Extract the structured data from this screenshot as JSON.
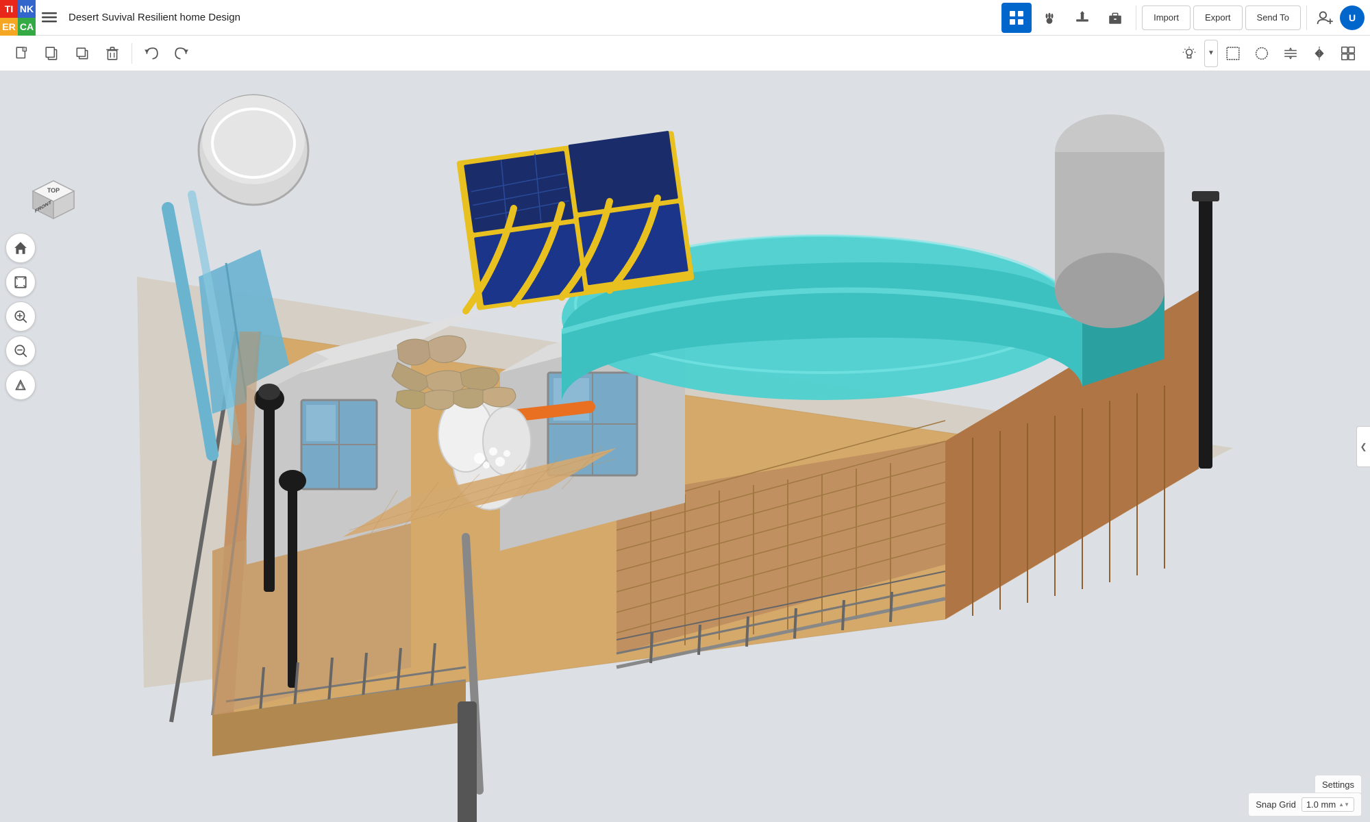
{
  "app": {
    "name": "Tinkercad",
    "logo": {
      "t": "TI",
      "n": "NK",
      "e": "ER",
      "k": "CA",
      "cells": [
        "T",
        "I",
        "N",
        "K"
      ]
    }
  },
  "header": {
    "project_title": "Desert Suvival Resilient home Design",
    "menu_icon": "☰",
    "tools": [
      {
        "id": "grid",
        "icon": "⊞",
        "active": true
      },
      {
        "id": "hand",
        "icon": "🖐"
      },
      {
        "id": "hammer",
        "icon": "🔨"
      },
      {
        "id": "briefcase",
        "icon": "💼"
      },
      {
        "id": "add-user",
        "icon": "👤+"
      },
      {
        "id": "avatar",
        "label": "U"
      }
    ],
    "buttons": {
      "import": "Import",
      "export": "Export",
      "send_to": "Send To"
    }
  },
  "toolbar": {
    "new_label": "new",
    "copy_label": "copy",
    "duplicate_label": "duplicate",
    "delete_label": "delete",
    "undo_label": "undo",
    "redo_label": "redo",
    "tools": [
      {
        "id": "new",
        "icon": "□"
      },
      {
        "id": "copy",
        "icon": "⧉"
      },
      {
        "id": "duplicate",
        "icon": "⧈"
      },
      {
        "id": "delete",
        "icon": "🗑"
      },
      {
        "id": "undo",
        "icon": "↩"
      },
      {
        "id": "redo",
        "icon": "↪"
      }
    ],
    "shape_tools": [
      {
        "id": "light",
        "icon": "💡"
      },
      {
        "id": "rect-select",
        "icon": "⬜"
      },
      {
        "id": "circle-select",
        "icon": "⭕"
      },
      {
        "id": "align",
        "icon": "⟺"
      },
      {
        "id": "mirror",
        "icon": "◈"
      },
      {
        "id": "group",
        "icon": "⊂"
      }
    ]
  },
  "view_controls": {
    "home": "⌂",
    "fit": "⊡",
    "zoom_in": "+",
    "zoom_out": "−",
    "perspective": "⬡"
  },
  "view_cube": {
    "top": "TOP",
    "front": "FRONT"
  },
  "bottom": {
    "settings_label": "Settings",
    "snap_grid_label": "Snap Grid",
    "snap_grid_value": "1.0 mm",
    "snap_grid_arrow": "▲▼"
  },
  "viewport": {
    "bg_color": "#dce0e5",
    "description": "3D model of Desert Survival Resilient Home Design - isometric top view"
  }
}
